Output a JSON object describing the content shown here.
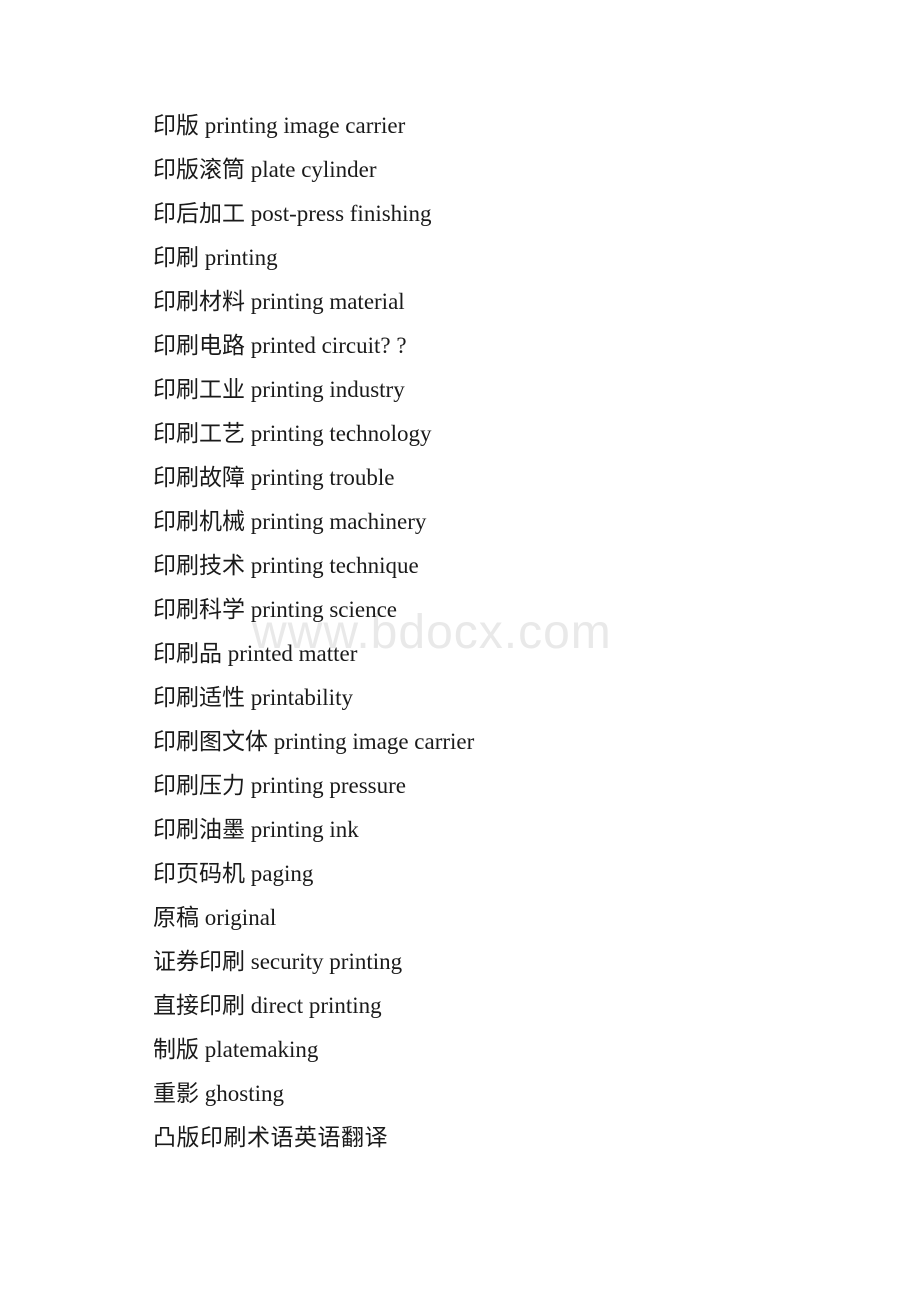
{
  "document": {
    "watermark": "www.bdocx.com",
    "lines": [
      {
        "text": "印版 printing image carrier"
      },
      {
        "text": "印版滚筒 plate cylinder"
      },
      {
        "text": "印后加工 post-press finishing"
      },
      {
        "text": "印刷 printing"
      },
      {
        "text": "印刷材料 printing material"
      },
      {
        "text": "印刷电路 printed circuit? ?"
      },
      {
        "text": "印刷工业 printing industry"
      },
      {
        "text": "印刷工艺 printing technology"
      },
      {
        "text": "印刷故障 printing trouble"
      },
      {
        "text": "印刷机械 printing machinery"
      },
      {
        "text": "印刷技术 printing technique"
      },
      {
        "text": "印刷科学 printing science"
      },
      {
        "text": "印刷品 printed matter"
      },
      {
        "text": "印刷适性 printability"
      },
      {
        "text": "印刷图文体 printing image carrier"
      },
      {
        "text": "印刷压力 printing pressure"
      },
      {
        "text": "印刷油墨 printing ink"
      },
      {
        "text": "印页码机 paging"
      },
      {
        "text": "原稿 original"
      },
      {
        "text": "证券印刷 security printing"
      },
      {
        "text": "直接印刷 direct printing"
      },
      {
        "text": "制版 platemaking"
      },
      {
        "text": "重影 ghosting"
      },
      {
        "text": "凸版印刷术语英语翻译"
      }
    ]
  }
}
